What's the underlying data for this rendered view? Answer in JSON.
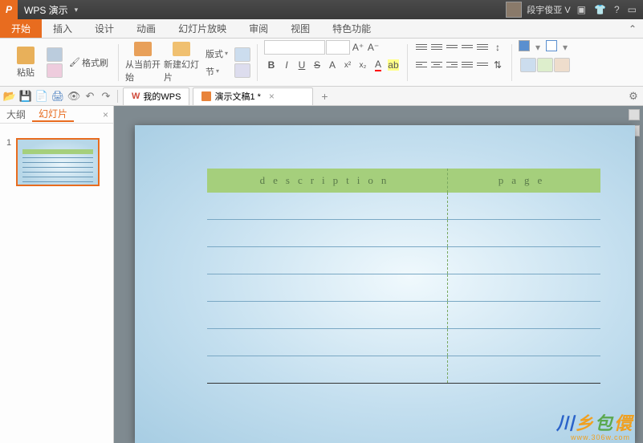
{
  "title": {
    "app_name": "WPS 演示",
    "user_name": "段宇俊亚 V"
  },
  "menu": {
    "tabs": [
      "开始",
      "插入",
      "设计",
      "动画",
      "幻灯片放映",
      "审阅",
      "视图",
      "特色功能"
    ],
    "active_index": 0
  },
  "ribbon": {
    "paste": "粘贴",
    "cut_tip": "剪切",
    "format_painter": "格式刷",
    "from_current": "从当前开始",
    "new_slide": "新建幻灯片",
    "layout": "版式",
    "section": "节",
    "reset_tip": "重置",
    "font_name": "",
    "font_size": "",
    "bold": "B",
    "italic": "I",
    "underline": "U",
    "strike": "S",
    "shadow": "A",
    "super": "x²",
    "sub": "x₂",
    "inc_font": "A⁺",
    "dec_font": "A⁻"
  },
  "qat": {
    "my_wps": "我的WPS",
    "doc_name": "演示文稿1 *"
  },
  "side": {
    "tab_outline": "大纲",
    "tab_slides": "幻灯片",
    "slide_num": "1"
  },
  "slide_table": {
    "headers": {
      "left": "description",
      "right": "page"
    },
    "rows": 7
  },
  "watermark": {
    "text_parts": [
      "川",
      "乡",
      "包",
      "儇"
    ],
    "url": "www.306w.com"
  }
}
